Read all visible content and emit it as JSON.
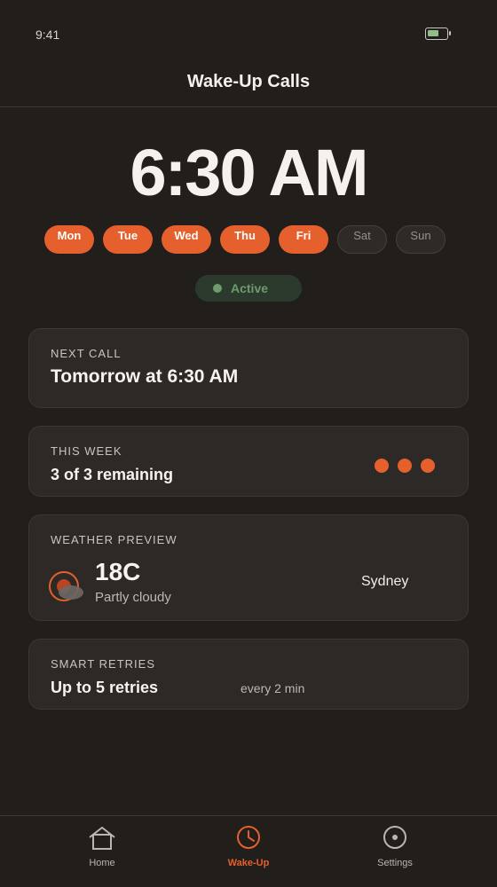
{
  "status_bar": {
    "time": "9:41",
    "battery_level": 0.55
  },
  "header": {
    "title": "Wake-Up Calls"
  },
  "alarm": {
    "time": "6:30 AM",
    "days": [
      {
        "label": "Mon",
        "enabled": true
      },
      {
        "label": "Tue",
        "enabled": true
      },
      {
        "label": "Wed",
        "enabled": true
      },
      {
        "label": "Thu",
        "enabled": true
      },
      {
        "label": "Fri",
        "enabled": true
      },
      {
        "label": "Sat",
        "enabled": false
      },
      {
        "label": "Sun",
        "enabled": false
      }
    ],
    "status": "Active"
  },
  "next_call": {
    "label": "NEXT CALL",
    "value": "Tomorrow at 6:30 AM"
  },
  "this_week": {
    "label": "THIS WEEK",
    "value": "3 of 3 remaining",
    "remaining": 3,
    "total": 3
  },
  "weather": {
    "label": "WEATHER PREVIEW",
    "temperature": "18C",
    "condition": "Partly cloudy",
    "city": "Sydney",
    "icon": "partly-cloudy-icon"
  },
  "retries": {
    "label": "SMART RETRIES",
    "value": "Up to 5 retries",
    "interval": "every 2 min"
  },
  "tabs": [
    {
      "label": "Home",
      "icon": "home-icon",
      "selected": false
    },
    {
      "label": "Wake-Up",
      "icon": "clock-icon",
      "selected": true
    },
    {
      "label": "Settings",
      "icon": "settings-icon",
      "selected": false
    }
  ],
  "colors": {
    "accent": "#e5602c",
    "background": "#211e1c",
    "card": "#2c2926",
    "active_green": "#6d9a6c"
  }
}
